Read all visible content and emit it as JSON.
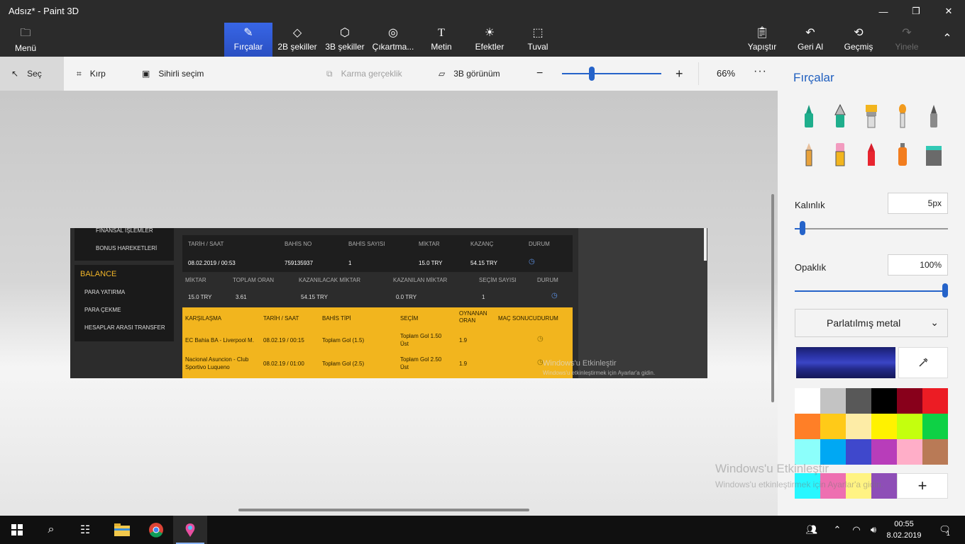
{
  "window": {
    "title": "Adsız* - Paint 3D"
  },
  "ribbon": {
    "menu_label": "Menü",
    "tools": [
      {
        "label": "Fırçalar",
        "icon": "brush-icon"
      },
      {
        "label": "2B şekiller",
        "icon": "2d-shapes-icon"
      },
      {
        "label": "3B şekiller",
        "icon": "3d-shapes-icon"
      },
      {
        "label": "Çıkartma...",
        "icon": "stickers-icon"
      },
      {
        "label": "Metin",
        "icon": "text-icon"
      },
      {
        "label": "Efektler",
        "icon": "effects-icon"
      },
      {
        "label": "Tuval",
        "icon": "canvas-icon"
      }
    ],
    "right_actions": [
      {
        "label": "Yapıştır",
        "icon": "paste-icon"
      },
      {
        "label": "Geri Al",
        "icon": "undo-icon"
      },
      {
        "label": "Geçmiş",
        "icon": "history-icon"
      },
      {
        "label": "Yinele",
        "icon": "redo-icon"
      }
    ]
  },
  "subtoolbar": {
    "select": "Seç",
    "crop": "Kırp",
    "magic_select": "Sihirli seçim",
    "mixed_reality": "Karma gerçeklik",
    "view_3d": "3B görünüm",
    "zoom_minus": "−",
    "zoom_plus": "+",
    "zoom_percent": "66%",
    "more": "···",
    "zoom_level": 0.3
  },
  "image_content": {
    "left_menu": [
      "FİNANSAL İŞLEMLER",
      "BONUS HAREKETLERİ"
    ],
    "balance_title": "BALANCE",
    "balance_items": [
      "PARA YATIRMA",
      "PARA ÇEKME",
      "HESAPLAR ARASI TRANSFER"
    ],
    "table1_headers": [
      "TARİH / SAAT",
      "BAHİS NO",
      "BAHİS SAYISI",
      "MİKTAR",
      "KAZANÇ",
      "DURUM"
    ],
    "table1_row": [
      "08.02.2019 / 00:53",
      "759135937",
      "1",
      "15.0 TRY",
      "54.15 TRY"
    ],
    "table2_headers": [
      "MİKTAR",
      "TOPLAM ORAN",
      "KAZANILACAK MİKTAR",
      "KAZANILAN MİKTAR",
      "SEÇİM SAYISI",
      "DURUM"
    ],
    "table2_row": [
      "15.0 TRY",
      "3.61",
      "54.15 TRY",
      "0.0 TRY",
      "1"
    ],
    "table3_headers": [
      "KARŞILAŞMA",
      "TARİH / SAAT",
      "BAHİS TİPİ",
      "SEÇİM",
      "OYNANAN ORAN",
      "MAÇ SONUCU",
      "DURUM"
    ],
    "table3_rows": [
      [
        "EC Bahia BA - Liverpool M.",
        "08.02.19 / 00:15",
        "Toplam Gol (1.5)",
        "Toplam Gol 1.50 Üst",
        "1.9"
      ],
      [
        "Nacional Asuncion - Club Sportivo Luqueno",
        "08.02.19 / 01:00",
        "Toplam Gol (2.5)",
        "Toplam Gol 2.50 Üst",
        "1.9"
      ]
    ],
    "watermark_title": "Windows'u Etkinleştir",
    "watermark_sub": "Windows'u etkinleştirmek için Ayarlar'a gidin."
  },
  "panel": {
    "title": "Fırçalar",
    "thickness_label": "Kalınlık",
    "thickness_value": "5px",
    "thickness_level": 0.05,
    "opacity_label": "Opaklık",
    "opacity_value": "100%",
    "opacity_level": 1.0,
    "material": "Parlatılmış metal",
    "add_color": "+",
    "palette": [
      "#ffffff",
      "#c3c3c3",
      "#585858",
      "#000000",
      "#88001b",
      "#ec1c24",
      "#ff7f27",
      "#ffca18",
      "#fdeca6",
      "#fff200",
      "#c4ff0e",
      "#0ed145",
      "#8cfffb",
      "#00a8f3",
      "#3f48cc",
      "#b83dba",
      "#ffaec8",
      "#b97a56"
    ],
    "custom_colors": [
      "#28f7ff",
      "#ee6fb1",
      "#fff383",
      "#8e4eb7"
    ],
    "selected_color": "#2b34a8"
  },
  "watermark": {
    "title": "Windows'u Etkinleştir",
    "sub": "Windows'u etkinleştirmek için Ayarlar'a gidin."
  },
  "taskbar": {
    "time": "00:55",
    "date": "8.02.2019",
    "notifications": "1"
  }
}
